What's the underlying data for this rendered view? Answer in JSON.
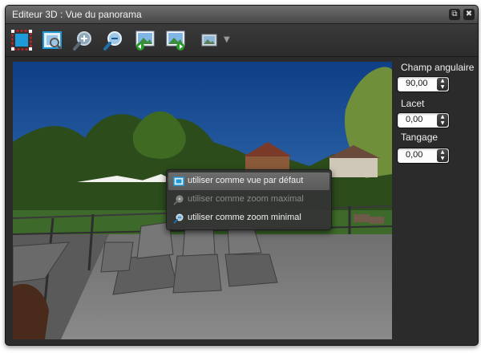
{
  "window": {
    "title": "Editeur 3D : Vue du panorama"
  },
  "titlebar": {
    "restore_glyph": "⧉",
    "close_glyph": "✖"
  },
  "toolbar": {
    "tools": [
      {
        "icon": "select-frame-icon"
      },
      {
        "icon": "frame-view-icon"
      },
      {
        "icon": "zoom-in-icon"
      },
      {
        "icon": "zoom-out-icon"
      },
      {
        "icon": "image-arrow-left-icon"
      },
      {
        "icon": "image-arrow-right-icon"
      },
      {
        "icon": "image-icon"
      }
    ],
    "dropdown_glyph": "▼"
  },
  "context_menu": {
    "items": [
      {
        "label": "utiliser comme vue par défaut",
        "state": "highlighted",
        "icon": "default-view-icon"
      },
      {
        "label": "utiliser comme zoom maximal",
        "state": "disabled",
        "icon": "zoom-max-icon"
      },
      {
        "label": "utiliser comme zoom minimal",
        "state": "enabled",
        "icon": "zoom-min-icon"
      }
    ]
  },
  "panel": {
    "champ_label": "Champ angulaire",
    "champ_value": "90,00",
    "lacet_label": "Lacet",
    "lacet_value": "0,00",
    "tangage_label": "Tangage",
    "tangage_value": "0,00",
    "spin_up": "▲",
    "spin_down": "▼"
  },
  "colors": {
    "window_bg": "#2b2b2b",
    "titlebar": "#5a5a5a",
    "menu_highlight": "#626262",
    "accent_blue": "#1f9ad8"
  }
}
